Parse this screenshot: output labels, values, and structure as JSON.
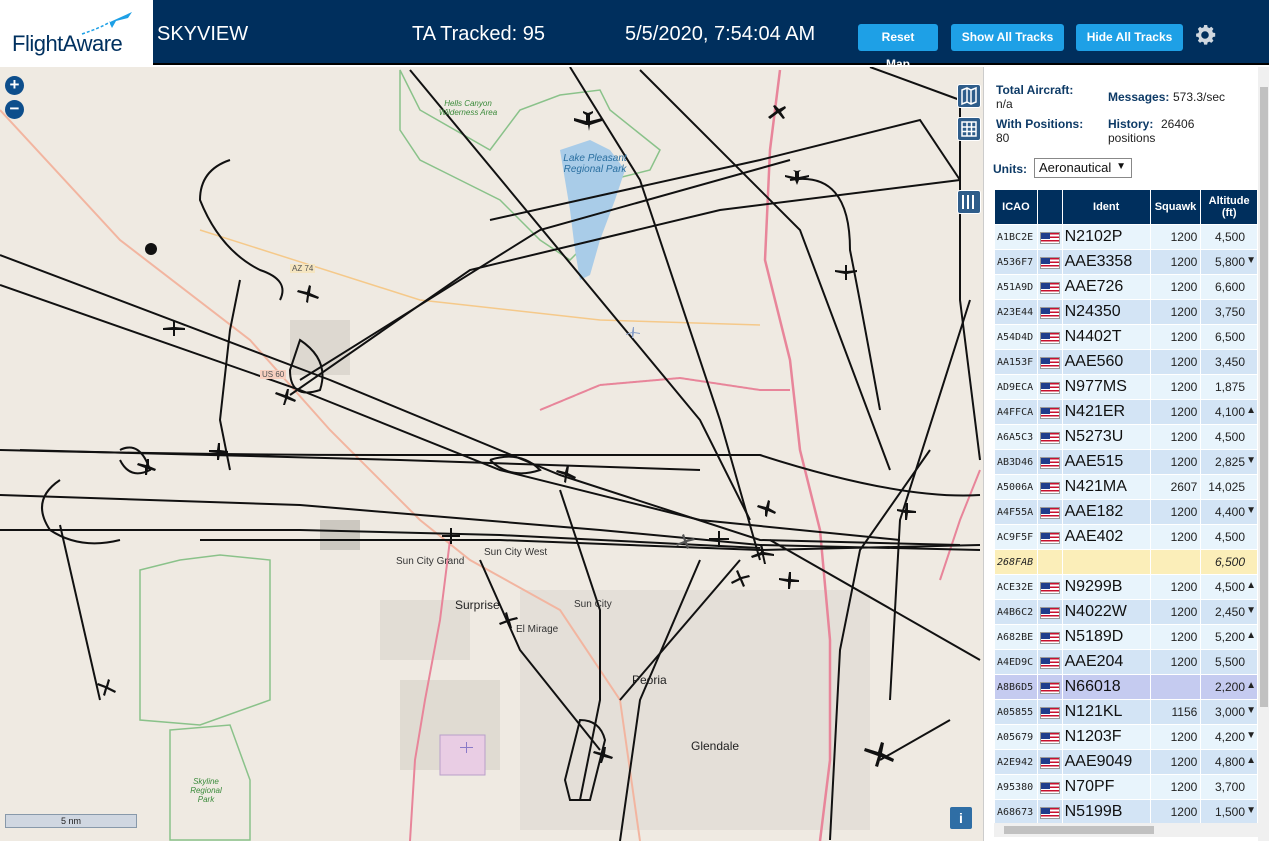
{
  "header": {
    "logo": "FlightAware",
    "app_title": "SKYVIEW",
    "tracked": "TA Tracked: 95",
    "datetime": "5/5/2020, 7:54:04 AM",
    "buttons": {
      "reset": "Reset Map",
      "show": "Show All Tracks",
      "hide": "Hide All Tracks"
    }
  },
  "map": {
    "zoom_in": "+",
    "zoom_out": "−",
    "scale": "5 nm",
    "info": "i",
    "labels": {
      "hells_canyon": "Hells Canyon Wilderness Area",
      "lake_pleasant": "Lake Pleasant Regional Park",
      "sun_city_grand": "Sun City Grand",
      "sun_city_west": "Sun City West",
      "surprise": "Surprise",
      "sun_city": "Sun City",
      "el_mirage": "El Mirage",
      "peoria": "Peoria",
      "glendale": "Glendale",
      "skyline": "Skyline Regional Park",
      "az74": "AZ 74",
      "us60": "US 60"
    }
  },
  "panel": {
    "total_aircraft_label": "Total Aircraft:",
    "total_aircraft": "n/a",
    "messages_label": "Messages:",
    "messages": "573.3/sec",
    "with_positions_label": "With Positions:",
    "with_positions": "80",
    "history_label": "History:",
    "history": "26406 positions",
    "units_label": "Units:",
    "units_value": "Aeronautical",
    "columns": [
      "ICAO",
      "",
      "Ident",
      "Squawk",
      "Altitude (ft)"
    ],
    "rows": [
      {
        "icao": "A1BC2E",
        "ident": "N2102P",
        "squawk": "1200",
        "alt": "4,500",
        "trend": ""
      },
      {
        "icao": "A536F7",
        "ident": "AAE3358",
        "squawk": "1200",
        "alt": "5,800",
        "trend": "▼"
      },
      {
        "icao": "A51A9D",
        "ident": "AAE726",
        "squawk": "1200",
        "alt": "6,600",
        "trend": ""
      },
      {
        "icao": "A23E44",
        "ident": "N24350",
        "squawk": "1200",
        "alt": "3,750",
        "trend": ""
      },
      {
        "icao": "A54D4D",
        "ident": "N4402T",
        "squawk": "1200",
        "alt": "6,500",
        "trend": ""
      },
      {
        "icao": "AA153F",
        "ident": "AAE560",
        "squawk": "1200",
        "alt": "3,450",
        "trend": ""
      },
      {
        "icao": "AD9ECA",
        "ident": "N977MS",
        "squawk": "1200",
        "alt": "1,875",
        "trend": ""
      },
      {
        "icao": "A4FFCA",
        "ident": "N421ER",
        "squawk": "1200",
        "alt": "4,100",
        "trend": "▲"
      },
      {
        "icao": "A6A5C3",
        "ident": "N5273U",
        "squawk": "1200",
        "alt": "4,500",
        "trend": ""
      },
      {
        "icao": "AB3D46",
        "ident": "AAE515",
        "squawk": "1200",
        "alt": "2,825",
        "trend": "▼"
      },
      {
        "icao": "A5006A",
        "ident": "N421MA",
        "squawk": "2607",
        "alt": "14,025",
        "trend": ""
      },
      {
        "icao": "A4F55A",
        "ident": "AAE182",
        "squawk": "1200",
        "alt": "4,400",
        "trend": "▼"
      },
      {
        "icao": "AC9F5F",
        "ident": "AAE402",
        "squawk": "1200",
        "alt": "4,500",
        "trend": ""
      },
      {
        "icao": "268FAB",
        "ident": "",
        "squawk": "",
        "alt": "6,500",
        "trend": "",
        "nodata": true
      },
      {
        "icao": "ACE32E",
        "ident": "N9299B",
        "squawk": "1200",
        "alt": "4,500",
        "trend": "▲"
      },
      {
        "icao": "A4B6C2",
        "ident": "N4022W",
        "squawk": "1200",
        "alt": "2,450",
        "trend": "▼"
      },
      {
        "icao": "A682BE",
        "ident": "N5189D",
        "squawk": "1200",
        "alt": "5,200",
        "trend": "▲"
      },
      {
        "icao": "A4ED9C",
        "ident": "AAE204",
        "squawk": "1200",
        "alt": "5,500",
        "trend": ""
      },
      {
        "icao": "A8B6D5",
        "ident": "N66018",
        "squawk": "",
        "alt": "2,200",
        "trend": "▲",
        "selected": true
      },
      {
        "icao": "A05855",
        "ident": "N121KL",
        "squawk": "1156",
        "alt": "3,000",
        "trend": "▼"
      },
      {
        "icao": "A05679",
        "ident": "N1203F",
        "squawk": "1200",
        "alt": "4,200",
        "trend": "▼"
      },
      {
        "icao": "A2E942",
        "ident": "AAE9049",
        "squawk": "1200",
        "alt": "4,800",
        "trend": "▲"
      },
      {
        "icao": "A95380",
        "ident": "N70PF",
        "squawk": "1200",
        "alt": "3,700",
        "trend": ""
      },
      {
        "icao": "A68673",
        "ident": "N5199B",
        "squawk": "1200",
        "alt": "1,500",
        "trend": "▼"
      }
    ]
  }
}
